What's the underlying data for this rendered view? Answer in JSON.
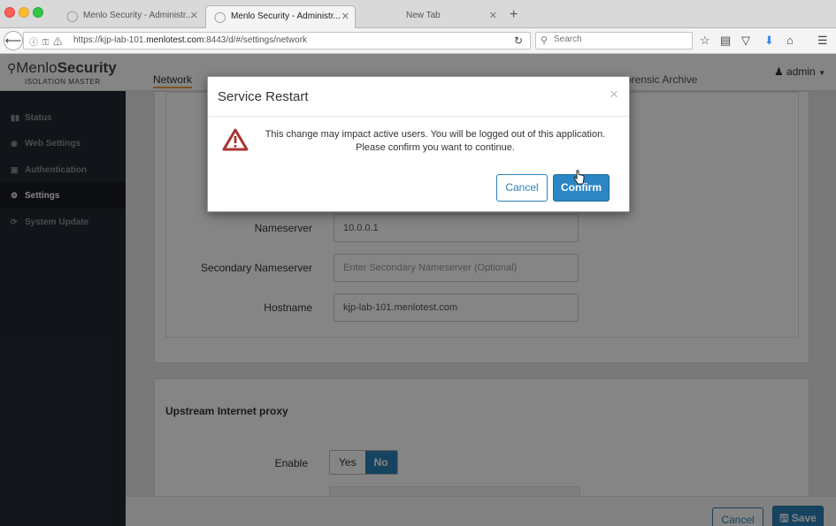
{
  "browser": {
    "tabs": [
      {
        "title": "Menlo Security - Administr...",
        "active": false
      },
      {
        "title": "Menlo Security - Administr...",
        "active": true
      },
      {
        "title": "New Tab",
        "active": false
      }
    ],
    "new_tab_symbol": "+",
    "url_prefix": "https://kjp-lab-101.",
    "url_domain": "menlotest.com",
    "url_suffix": ":8443/d/#/settings/network",
    "search_placeholder": "Search",
    "icons": [
      "back-arrow-icon",
      "info-icon",
      "key-icon",
      "lock-warning-icon",
      "reload-icon",
      "search-icon",
      "star-icon",
      "reading-list-icon",
      "pocket-icon",
      "download-icon",
      "home-icon",
      "hamburger-menu-icon"
    ]
  },
  "app": {
    "logo_light": "Menlo",
    "logo_bold": "Security",
    "logo_sub": "ISOLATION MASTER",
    "top_nav": {
      "network": "Network",
      "forensic": "orensic Archive"
    },
    "user": "admin",
    "sidebar": [
      {
        "label": "Status",
        "icon": "bar-chart-icon",
        "active": false
      },
      {
        "label": "Web Settings",
        "icon": "globe-icon",
        "active": false
      },
      {
        "label": "Authentication",
        "icon": "lock-icon",
        "active": false
      },
      {
        "label": "Settings",
        "icon": "gear-icon",
        "active": true
      },
      {
        "label": "System Update",
        "icon": "refresh-icon",
        "active": false
      }
    ],
    "form": {
      "nameserver_label": "Nameserver",
      "nameserver_value": "10.0.0.1",
      "secondary_label": "Secondary Nameserver",
      "secondary_placeholder": "Enter Secondary Nameserver (Optional)",
      "hostname_label": "Hostname",
      "hostname_value": "kjp-lab-101.menlotest.com"
    },
    "proxy": {
      "title": "Upstream Internet proxy",
      "enable_label": "Enable",
      "yes": "Yes",
      "no": "No",
      "selected": "No"
    },
    "footer": {
      "cancel": "Cancel",
      "save": "Save"
    }
  },
  "modal": {
    "title": "Service Restart",
    "close": "×",
    "message_line1": "This change may impact active users. You will be logged out of this application.",
    "message_line2": "Please confirm you want to continue.",
    "cancel": "Cancel",
    "confirm": "Confirm"
  }
}
